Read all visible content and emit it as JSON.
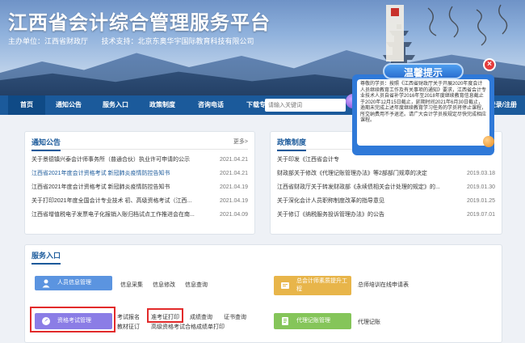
{
  "header": {
    "title": "江西省会计综合管理服务平台",
    "sponsor": "主办单位：江西省财政厅",
    "tech_support": "技术支持：北京东奥华宇国际教育科技有限公司"
  },
  "nav": {
    "items": [
      "首页",
      "通知公告",
      "服务入口",
      "政策制度",
      "咨询电话",
      "下载专区"
    ],
    "search_placeholder": "请输入关键词",
    "login": "登录/注册"
  },
  "notices": {
    "title": "通知公告",
    "more": "更多>",
    "rows": [
      {
        "text": "关于景德镇兴泰会计师事务所（普通合伙）执业许可申请的公示",
        "date": "2021.04.21"
      },
      {
        "text": "江西省2021年度会计资格考试 新冠肺炎疫情防控告知书",
        "date": "2021.04.21"
      },
      {
        "text": "江西省2021年度会计资格考试 新冠肺炎疫情防控告知书",
        "date": "2021.04.19"
      },
      {
        "text": "关于打印2021年度全国会计专业技术 初、高级资格考试（江西...",
        "date": "2021.04.19"
      },
      {
        "text": "江西省增值税电子发票电子化报销入账归档试点工作推进会在南...",
        "date": "2021.04.09"
      }
    ]
  },
  "policies": {
    "title": "政策制度",
    "rows": [
      {
        "text": "关于印发《江西省会计专",
        "date": ""
      },
      {
        "text": "财政部关于修改《代理记账管理办法》等2部部门规章的决定",
        "date": "2019.03.18"
      },
      {
        "text": "江西省财政厅关于转发财政部《永续债相关会计处理的规定》的...",
        "date": "2019.01.30"
      },
      {
        "text": "关于深化会计人员职称制度改革的指导意见",
        "date": "2019.01.25"
      },
      {
        "text": "关于修订《纳税服务投诉管理办法》的公告",
        "date": "2019.07.01"
      }
    ]
  },
  "services": {
    "title": "服务入口",
    "personal": {
      "label": "人员信息管理",
      "links": [
        "信息采集",
        "信息修改",
        "信息查询"
      ]
    },
    "training": {
      "label": "总会计师素质提升工程",
      "links": [
        "总师培训在线申请表"
      ]
    },
    "exam": {
      "label": "资格考试管理",
      "links": [
        "考试报名",
        "准考证打印",
        "成绩查询",
        "证书查询",
        "教材征订",
        "高级资格考试合格成绩单打印"
      ]
    },
    "bookkeeping": {
      "label": "代理记账管理",
      "links": [
        "代理记账"
      ]
    }
  },
  "popup": {
    "title": "温馨提示",
    "close": "×",
    "body": "尊敬的学员：按照《江西省财政厅关于开展2020年度会计人员继续教育工作及有关事项的通知》要求，江西省会计专业技术人员自省补学2016年至2018年度继续教育信息截止于2020年12月15日截止，延期时间2021年6月30日截止，逾期未完成上述年度继续教育学习任务的学员将停止课程，所交纳费用不予退还。请广大会计学员按规定尽快完成相应课程。"
  },
  "colors": {
    "nav_bg": "#1b5a9b",
    "personal_btn": "#5b94e0",
    "training_btn": "#e8b54a",
    "exam_btn": "#8b7de6",
    "bookkeeping_btn": "#85c55a",
    "highlight_box": "#e22b2b"
  }
}
